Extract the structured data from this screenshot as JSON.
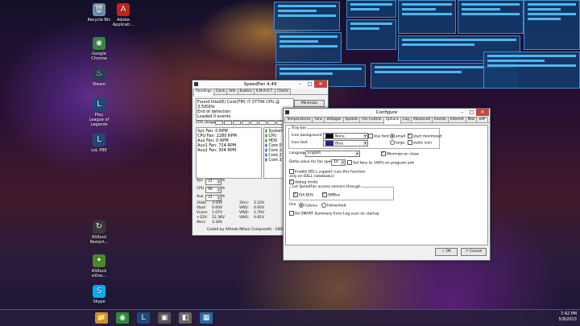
{
  "desktop": {
    "icons": [
      {
        "label": "Recycle Bin",
        "glyph": "🗑",
        "color": "#6b8fb0"
      },
      {
        "label": "Adobe Applicati...",
        "glyph": "A",
        "color": "#c8201e"
      },
      {
        "label": "Google Chrome",
        "glyph": "◉",
        "color": "#2e8b3c"
      },
      {
        "label": "Steam",
        "glyph": "♨",
        "color": "#2a3b55"
      },
      {
        "label": "Play League of Legends",
        "glyph": "L",
        "color": "#1e4a7a"
      },
      {
        "label": "LoL PBE",
        "glyph": "L",
        "color": "#1e4a7a"
      },
      {
        "label": "ASRock Restart...",
        "glyph": "↻",
        "color": "#3a3a3a"
      },
      {
        "label": "ASRock eXtre...",
        "glyph": "✦",
        "color": "#4a8a20"
      },
      {
        "label": "Skype",
        "glyph": "S",
        "color": "#00aff0"
      }
    ]
  },
  "speedfan": {
    "title": "SpeedFan 4.49",
    "tabs": [
      "Readings",
      "Clock",
      "Info",
      "Exotics",
      "S.M.A.R.T.",
      "Charts"
    ],
    "log": [
      "Found Intel(R) Core(TM) i7-3770K CPU @ 3.50GHz",
      "End of detection",
      "Loaded 0 events"
    ],
    "minimize_label": "Minimize",
    "configure_label": "Configure",
    "cpu_usage_label": "CPU Usage",
    "fans": [
      "Sys Fan: 0 RPM",
      "CPU Fan: 2280 RPM",
      "Aux Fan: 0 RPM",
      "Aux1 Fan: 724 RPM",
      "Aux2 Fan: 304 RPM"
    ],
    "temps": [
      "System",
      "CPU",
      "HD0",
      "Core 0",
      "Core 1",
      "Core 2",
      "Core 3"
    ],
    "speeds": [
      {
        "label": "Sys",
        "value": "31",
        "unit": "%"
      },
      {
        "label": "CPU",
        "value": "96",
        "unit": "%"
      },
      {
        "label": "Aux",
        "value": "31",
        "unit": "%"
      }
    ],
    "voltages_left": [
      {
        "name": "3Vsb:",
        "value": "3.50V"
      },
      {
        "name": "Vbat:",
        "value": "0.00V"
      },
      {
        "name": "Vcore:",
        "value": "1.07V"
      },
      {
        "name": "+12V:",
        "value": "12.36V"
      },
      {
        "name": "AVcc:",
        "value": "3.34V"
      }
    ],
    "voltages_right": [
      {
        "name": "3Vcc:",
        "value": "3.32V"
      },
      {
        "name": "VIN1:",
        "value": "0.92V"
      },
      {
        "name": "VIN2:",
        "value": "1.70V"
      },
      {
        "name": "VIN3:",
        "value": "0.91V"
      }
    ],
    "footer": "Coded by Alfredo Milani Comparetti - 2000-2013"
  },
  "configure": {
    "title": "Configure",
    "tabs": [
      "Temperatures",
      "Fans",
      "Voltages",
      "Speeds",
      "Fan Control",
      "Options",
      "Log",
      "Advanced",
      "Events",
      "Internet",
      "Mail",
      "xAP"
    ],
    "active_tab": "Options",
    "trayicon_legend": "Tray bar",
    "icon_background_label": "Icon background",
    "icon_background_value": "None",
    "icon_background_color": "#000000",
    "icon_text_label": "Icon text",
    "icon_text_value": "Blue",
    "icon_text_color": "#1020c0",
    "use_font_label": "Use font",
    "font_small_label": "small",
    "font_large_label": "large",
    "start_minimized_label": "start minimized",
    "static_icon_label": "static icon",
    "language_label": "Language",
    "language_value": "English",
    "minimize_on_close_label": "Minimize on close",
    "delta_label": "Delta value for fan speeds",
    "delta_value": "10",
    "set_fans_label": "Set fans to 100% on program exit",
    "dell_label": "Enable DELL support (use this function only on DELL notebooks)",
    "debug_label": "debug mode",
    "access_legend": "Let SpeedFan access sensors through",
    "isa_label": "ISA BUS",
    "smbus_label": "SMBus",
    "use_label": "Use",
    "celsius_label": "Celsius",
    "fahrenheit_label": "Fahrenheit",
    "smart_label": "Do SMART Summary Error Log scan on startup",
    "ok_label": "OK",
    "cancel_label": "Cancel"
  },
  "taskbar": {
    "items": [
      "📁",
      "◉",
      "L",
      "▣",
      "◧",
      "▦"
    ],
    "time": "7:42 PM",
    "date": "5/9/2013"
  }
}
